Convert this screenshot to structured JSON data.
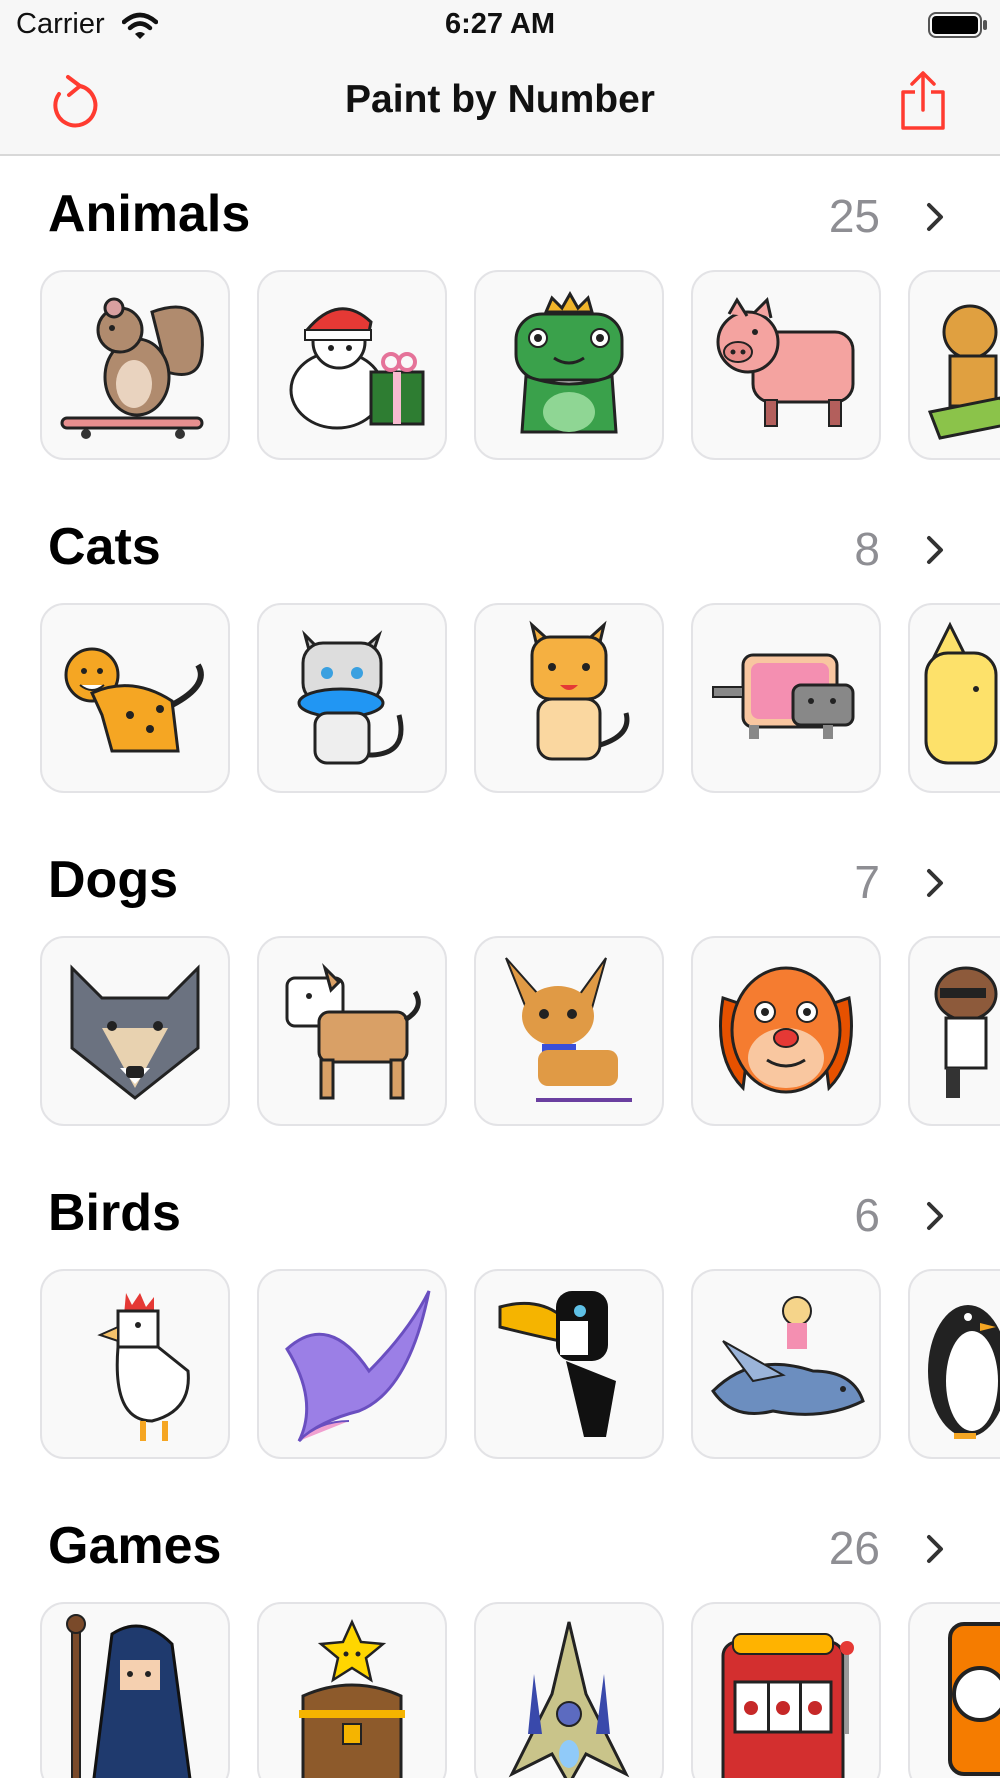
{
  "status_bar": {
    "carrier": "Carrier",
    "time": "6:27 AM"
  },
  "nav": {
    "title": "Paint by Number",
    "left_icon": "refresh-icon",
    "right_icon": "share-icon",
    "accent": "#ff3b30"
  },
  "sections": [
    {
      "title": "Animals",
      "count": "25",
      "items": [
        "squirrel-skateboard",
        "polar-bear-santa-hat-gift",
        "frog-with-crown",
        "pig",
        "deer-sled"
      ]
    },
    {
      "title": "Cats",
      "count": "8",
      "items": [
        "leopard",
        "white-cat-with-fish",
        "striped-tabby-cat",
        "nyan-cat",
        "yellow-cat"
      ]
    },
    {
      "title": "Dogs",
      "count": "7",
      "items": [
        "wolf-head",
        "shiba-dog",
        "chihuahua",
        "floppy-ear-dog-face",
        "dog-with-sunglasses"
      ]
    },
    {
      "title": "Birds",
      "count": "6",
      "items": [
        "chicken",
        "purple-dove",
        "toucan",
        "girl-riding-bird",
        "penguin"
      ]
    },
    {
      "title": "Games",
      "count": "26",
      "items": [
        "wizard-with-staff",
        "treasure-chest-with-star",
        "spaceship",
        "slot-machine",
        "question-block"
      ]
    }
  ]
}
